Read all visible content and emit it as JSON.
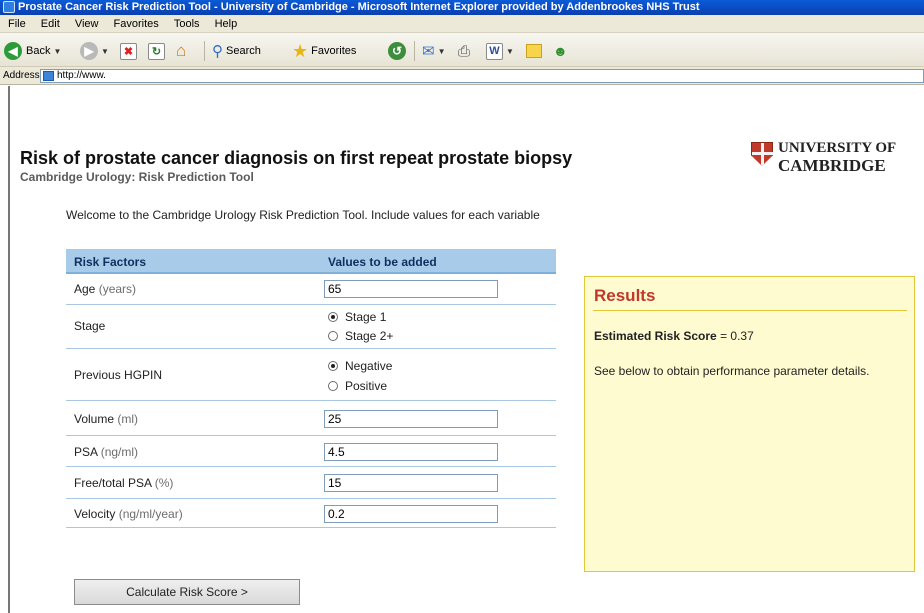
{
  "browser": {
    "title": "Prostate Cancer Risk Prediction Tool - University of Cambridge - Microsoft Internet Explorer provided by Addenbrookes NHS Trust",
    "menu": [
      "File",
      "Edit",
      "View",
      "Favorites",
      "Tools",
      "Help"
    ],
    "toolbar": {
      "back_label": "Back",
      "search_label": "Search",
      "favorites_label": "Favorites",
      "word_glyph": "W"
    },
    "address_label": "Address",
    "address_url": "http://www."
  },
  "page": {
    "title": "Risk of prostate cancer diagnosis on first repeat prostate biopsy",
    "subtitle": "Cambridge Urology: Risk Prediction Tool",
    "logo_line1": "UNIVERSITY OF",
    "logo_line2": "CAMBRIDGE",
    "welcome": "Welcome to the Cambridge Urology Risk Prediction Tool. Include values for each variable"
  },
  "table": {
    "col_factors": "Risk Factors",
    "col_values": "Values to be added",
    "age": {
      "label": "Age",
      "unit": "(years)",
      "value": "65"
    },
    "stage": {
      "label": "Stage",
      "options": [
        "Stage 1",
        "Stage 2+"
      ],
      "selected": "Stage 1"
    },
    "hgpin": {
      "label": "Previous HGPIN",
      "options": [
        "Negative",
        "Positive"
      ],
      "selected": "Negative"
    },
    "volume": {
      "label": "Volume",
      "unit": "(ml)",
      "value": "25"
    },
    "psa": {
      "label": "PSA",
      "unit": "(ng/ml)",
      "value": "4.5"
    },
    "free_psa": {
      "label": "Free/total PSA",
      "unit": "(%)",
      "value": "15"
    },
    "velocity": {
      "label": "Velocity",
      "unit": "(ng/ml/year)",
      "value": "0.2"
    }
  },
  "calculate_label": "Calculate Risk Score >",
  "results": {
    "title": "Results",
    "score_label": "Estimated Risk Score",
    "score_value": "= 0.37",
    "note": "See below to obtain performance parameter details."
  },
  "colors": {
    "title_bar": "#0a4bc4",
    "table_header": "#a8cbea",
    "results_bg": "#fefbd0",
    "results_title": "#c0392b"
  }
}
